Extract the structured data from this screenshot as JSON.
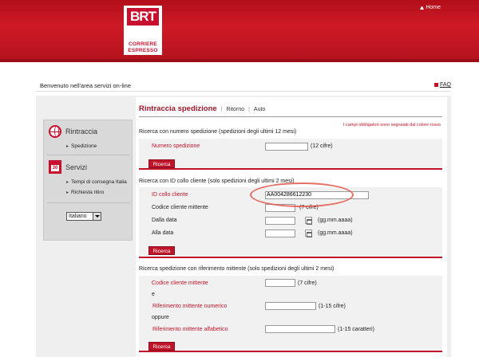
{
  "header": {
    "home_label": "Home",
    "logo": {
      "brand": "BRT",
      "line1": "CORRIERE",
      "line2": "ESPRESSO"
    },
    "welcome_text": "Benvenuto  nell'area servizi on-line",
    "faq_label": "FAQ"
  },
  "sidebar": {
    "rintraccia": {
      "title": "Rintraccia",
      "icon": "globe-icon",
      "items": [
        "Spedizione"
      ]
    },
    "servizi": {
      "title": "Servizi",
      "icon": "calendar-icon",
      "items": [
        "Tempi di consegna Italia",
        "Richiesta ritiro"
      ]
    },
    "language": {
      "selected": "Italiano"
    }
  },
  "main": {
    "tabs": [
      {
        "label": "Rintraccia spedizione",
        "active": true
      },
      {
        "label": "Ritorno",
        "active": false
      },
      {
        "label": "Auto",
        "active": false
      }
    ],
    "required_note": "I campi obbligatori sono segnalati dal colore rosso",
    "section1": {
      "title": "Ricerca con numero spedizione (spedizioni degli ultimi 12 mesi)",
      "field_label": "Numero spedizione",
      "field_value": "",
      "hint": "(12 cifre)",
      "button": "Ricerca"
    },
    "section2": {
      "title": "Ricerca con ID collo cliente (solo spedizioni degli ultimi 2 mesi)",
      "id_label": "ID collo cliente",
      "id_value": "AA004286612230",
      "codice_label": "Codice cliente mittente",
      "codice_hint": "(7 cifre)",
      "dalla_label": "Dalla data",
      "alla_label": "Alla data",
      "date_hint": "(gg.mm.aaaa)",
      "button": "Ricerca"
    },
    "section3": {
      "title": "Ricerca spedizione con riferimento mittente (solo spedizioni degli ultimi 2 mesi)",
      "codice_label": "Codice cliente mittente",
      "codice_hint": "(7 cifre)",
      "e_label": "e",
      "numerico_label": "Riferimento mittente numerico",
      "numerico_hint": "(1-15 cifre)",
      "oppure_label": "oppure",
      "alfabetico_label": "Riferimento mittente alfabetico",
      "alfabetico_hint": "(1-15 caratteri)",
      "button": "Ricerca"
    }
  },
  "colors": {
    "brand_red": "#c8102e",
    "annotation": "#e2574b"
  }
}
